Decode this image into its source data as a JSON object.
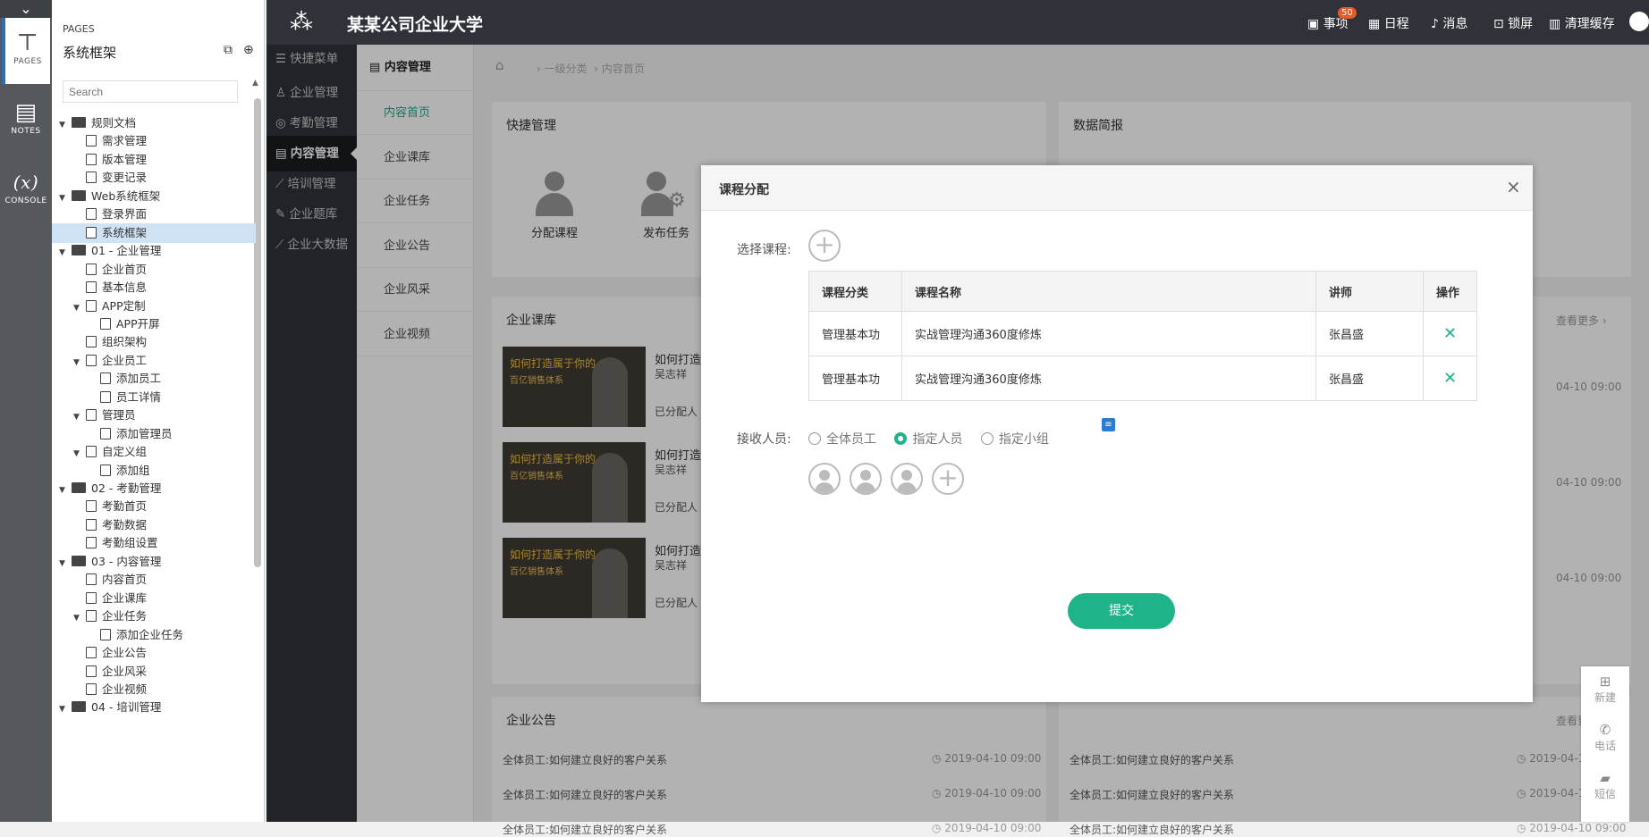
{
  "rail": {
    "items": [
      {
        "label": "PAGES",
        "icon": "sitemap-icon"
      },
      {
        "label": "NOTES",
        "icon": "notes-icon"
      },
      {
        "label": "CONSOLE",
        "icon": "variable-icon",
        "glyph": "(x)"
      }
    ]
  },
  "tree": {
    "header": "PAGES",
    "title": "系统框架",
    "search_placeholder": "Search",
    "nodes": [
      {
        "label": "规则文档",
        "level": 0,
        "type": "folder",
        "open": true
      },
      {
        "label": "需求管理",
        "level": 1,
        "type": "page"
      },
      {
        "label": "版本管理",
        "level": 1,
        "type": "page"
      },
      {
        "label": "变更记录",
        "level": 1,
        "type": "page"
      },
      {
        "label": "Web系统框架",
        "level": 0,
        "type": "folder",
        "open": true
      },
      {
        "label": "登录界面",
        "level": 1,
        "type": "page"
      },
      {
        "label": "系统框架",
        "level": 1,
        "type": "page",
        "selected": true
      },
      {
        "label": "01 - 企业管理",
        "level": 0,
        "type": "folder",
        "open": true
      },
      {
        "label": "企业首页",
        "level": 1,
        "type": "page"
      },
      {
        "label": "基本信息",
        "level": 1,
        "type": "page"
      },
      {
        "label": "APP定制",
        "level": 1,
        "type": "page",
        "open": true
      },
      {
        "label": "APP开屏",
        "level": 2,
        "type": "page"
      },
      {
        "label": "组织架构",
        "level": 1,
        "type": "page"
      },
      {
        "label": "企业员工",
        "level": 1,
        "type": "page",
        "open": true
      },
      {
        "label": "添加员工",
        "level": 2,
        "type": "page"
      },
      {
        "label": "员工详情",
        "level": 2,
        "type": "page"
      },
      {
        "label": "管理员",
        "level": 1,
        "type": "page",
        "open": true
      },
      {
        "label": "添加管理员",
        "level": 2,
        "type": "page"
      },
      {
        "label": "自定义组",
        "level": 1,
        "type": "page",
        "open": true
      },
      {
        "label": "添加组",
        "level": 2,
        "type": "page"
      },
      {
        "label": "02 - 考勤管理",
        "level": 0,
        "type": "folder",
        "open": true
      },
      {
        "label": "考勤首页",
        "level": 1,
        "type": "page"
      },
      {
        "label": "考勤数据",
        "level": 1,
        "type": "page"
      },
      {
        "label": "考勤组设置",
        "level": 1,
        "type": "page"
      },
      {
        "label": "03 - 内容管理",
        "level": 0,
        "type": "folder",
        "open": true
      },
      {
        "label": "内容首页",
        "level": 1,
        "type": "page"
      },
      {
        "label": "企业课库",
        "level": 1,
        "type": "page"
      },
      {
        "label": "企业任务",
        "level": 1,
        "type": "page",
        "open": true
      },
      {
        "label": "添加企业任务",
        "level": 2,
        "type": "page"
      },
      {
        "label": "企业公告",
        "level": 1,
        "type": "page"
      },
      {
        "label": "企业风采",
        "level": 1,
        "type": "page"
      },
      {
        "label": "企业视频",
        "level": 1,
        "type": "page"
      },
      {
        "label": "04 - 培训管理",
        "level": 0,
        "type": "folder",
        "open": true
      }
    ]
  },
  "header": {
    "title": "某某公司企业大学",
    "items": [
      {
        "label": "事项",
        "icon": "clipboard-icon",
        "badge": "50"
      },
      {
        "label": "日程",
        "icon": "calendar-icon"
      },
      {
        "label": "消息",
        "icon": "bell-icon"
      },
      {
        "label": "锁屏",
        "icon": "lock-icon"
      },
      {
        "label": "清理缓存",
        "icon": "trash-icon"
      }
    ]
  },
  "menu": {
    "items": [
      {
        "label": "快捷菜单",
        "glyph": "☰"
      },
      {
        "label": "企业管理",
        "glyph": "♙"
      },
      {
        "label": "考勤管理",
        "glyph": "◎"
      },
      {
        "label": "内容管理",
        "glyph": "▤",
        "active": true
      },
      {
        "label": "培训管理",
        "glyph": "⟋"
      },
      {
        "label": "企业题库",
        "glyph": "✎"
      },
      {
        "label": "企业大数据",
        "glyph": "⟋"
      }
    ]
  },
  "submenu": {
    "header": "内容管理",
    "items": [
      {
        "label": "内容首页",
        "active": true
      },
      {
        "label": "企业课库"
      },
      {
        "label": "企业任务"
      },
      {
        "label": "企业公告"
      },
      {
        "label": "企业风采"
      },
      {
        "label": "企业视频"
      }
    ]
  },
  "breadcrumb": [
    "一级分类",
    "内容首页"
  ],
  "background": {
    "quick": {
      "title": "快捷管理",
      "items": [
        "分配课程",
        "发布任务"
      ]
    },
    "brief": {
      "title": "数据简报"
    },
    "courses": {
      "title": "企业课库",
      "more": "查看更多",
      "items": [
        {
          "title": "如何打造",
          "author": "吴志祥",
          "assign": "已分配人",
          "time": "04-10 09:00",
          "thumb_title": "如何打造属于你的",
          "thumb_sub": "百亿销售体系"
        },
        {
          "title": "如何打造",
          "author": "吴志祥",
          "assign": "已分配人",
          "time": "04-10 09:00",
          "thumb_title": "如何打造属于你的",
          "thumb_sub": "百亿销售体系"
        },
        {
          "title": "如何打造",
          "author": "吴志祥",
          "assign": "已分配人",
          "time": "04-10 09:00",
          "thumb_title": "如何打造属于你的",
          "thumb_sub": "百亿销售体系"
        }
      ]
    },
    "notices": {
      "title": "企业公告",
      "more": "查看更多",
      "rows": [
        {
          "text": "全体员工:如何建立良好的客户关系",
          "time": "2019-04-10 09:00"
        },
        {
          "text": "全体员工:如何建立良好的客户关系",
          "time": "2019-04-10 09:00"
        },
        {
          "text": "全体员工:如何建立良好的客户关系",
          "time": "2019-04-10 09:00"
        }
      ],
      "rows_right": [
        {
          "text": "全体员工:如何建立良好的客户关系",
          "time": "2019-04-10 09:00"
        },
        {
          "text": "全体员工:如何建立良好的客户关系",
          "time": "2019-04-10 09:00"
        },
        {
          "text": "全体员工:如何建立良好的客户关系",
          "time": "2019-04-10 09:00"
        }
      ]
    }
  },
  "modal": {
    "title": "课程分配",
    "select_label": "选择课程:",
    "table": {
      "headers": [
        "课程分类",
        "课程名称",
        "讲师",
        "操作"
      ],
      "rows": [
        {
          "category": "管理基本功",
          "name": "实战管理沟通360度修炼",
          "teacher": "张昌盛"
        },
        {
          "category": "管理基本功",
          "name": "实战管理沟通360度修炼",
          "teacher": "张昌盛"
        }
      ]
    },
    "receiver_label": "接收人员:",
    "radios": [
      {
        "label": "全体员工",
        "checked": false
      },
      {
        "label": "指定人员",
        "checked": true
      },
      {
        "label": "指定小组",
        "checked": false
      }
    ],
    "submit": "提交"
  },
  "float_side": [
    {
      "label": "新建",
      "glyph": "⊞"
    },
    {
      "label": "电话",
      "glyph": "✆"
    },
    {
      "label": "短信",
      "glyph": "▰"
    }
  ],
  "colors": {
    "accent": "#1fb38a",
    "header": "#2f3339",
    "badge": "#e65b2a"
  }
}
